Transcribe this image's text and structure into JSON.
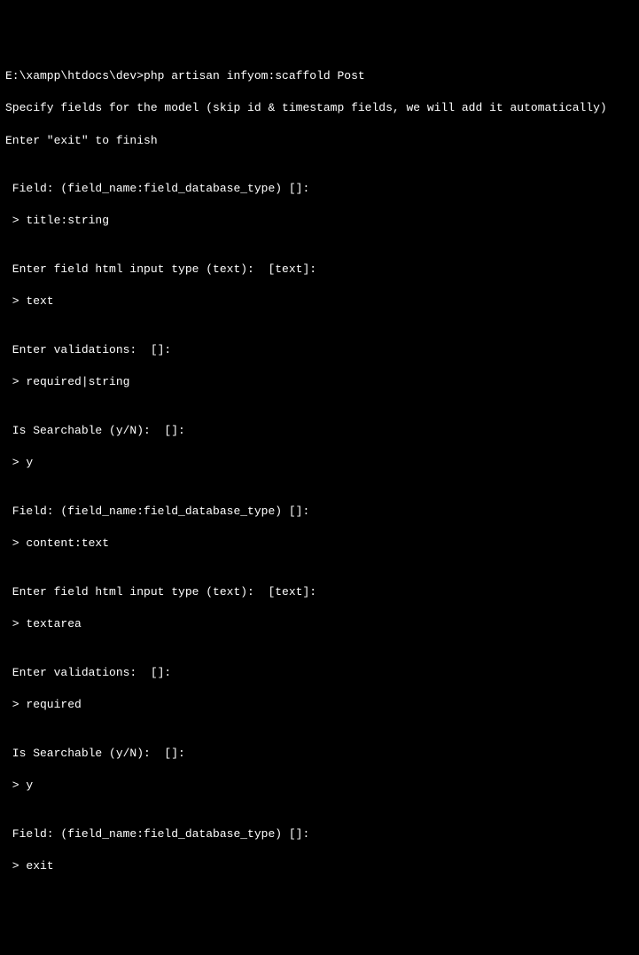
{
  "terminal": {
    "cwd": "E:\\xampp\\htdocs\\dev>",
    "command": "php artisan infyom:scaffold Post",
    "intro1": "Specify fields for the model (skip id & timestamp fields, we will add it automatically)",
    "intro2": "Enter \"exit\" to finish",
    "blank": "",
    "field_prompt": " Field: (field_name:field_database_type) []:",
    "field1_input": " > title:string",
    "html_type_prompt": " Enter field html input type (text):  [text]:",
    "html1_input": " > text",
    "validations_prompt": " Enter validations:  []:",
    "validations1_input": " > required|string",
    "searchable_prompt": " Is Searchable (y/N):  []:",
    "searchable1_input": " > y",
    "field2_input": " > content:text",
    "html2_input": " > textarea",
    "validations2_input": " > required",
    "searchable2_input": " > y",
    "exit_input": " > exit"
  }
}
